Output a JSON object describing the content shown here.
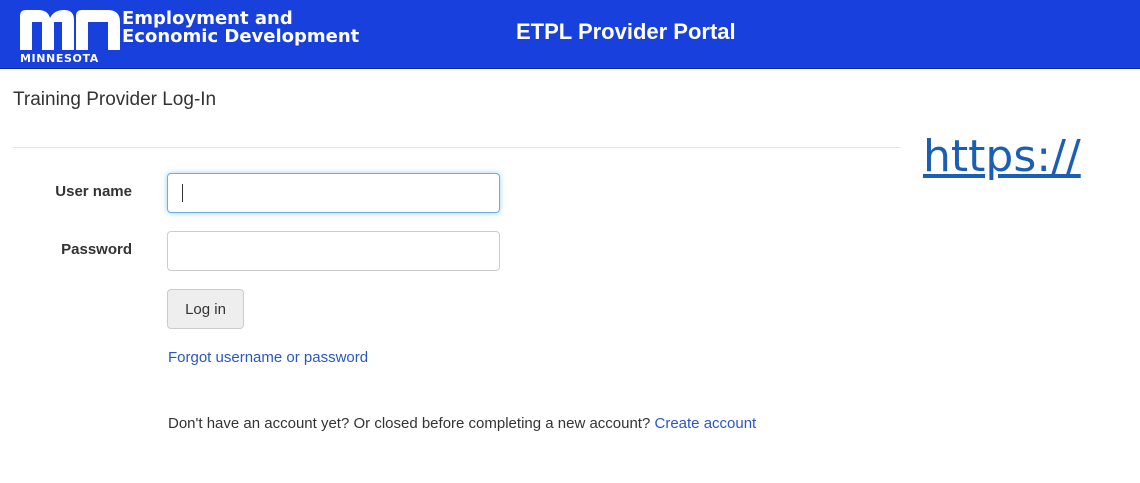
{
  "header": {
    "logo": {
      "state": "MINNESOTA",
      "org_line1": "Employment and",
      "org_line2": "Economic Development"
    },
    "portal_title": "ETPL Provider Portal"
  },
  "page": {
    "heading": "Training Provider Log-In",
    "url_text": "https://"
  },
  "form": {
    "username_label": "User name",
    "username_value": "",
    "password_label": "Password",
    "password_value": "",
    "login_label": "Log in",
    "forgot_link": "Forgot username or password",
    "account_prompt": "Don't have an account yet? Or closed before completing a new account?",
    "create_account_link": "Create account"
  },
  "colors": {
    "header_bg": "#1840dc",
    "link": "#2a57c4",
    "url": "#1a5fb4"
  }
}
